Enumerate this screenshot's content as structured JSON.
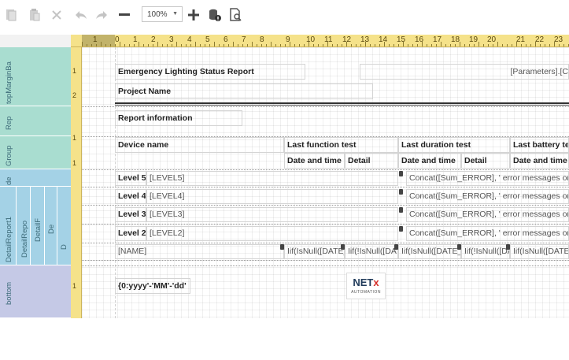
{
  "toolbar": {
    "zoom": "100%",
    "icons": [
      "copy-icon",
      "paste-icon",
      "delete-icon",
      "undo-icon",
      "redo-icon",
      "zoom-out-icon",
      "zoom-in-icon",
      "data-source-icon",
      "preview-icon"
    ]
  },
  "ruler": {
    "numbers": [
      "1",
      "0",
      "1",
      "2",
      "3",
      "4",
      "5",
      "6",
      "7",
      "8",
      "9",
      "10",
      "11",
      "12",
      "13",
      "14",
      "15",
      "16",
      "17",
      "18",
      "19",
      "20",
      "21",
      "22",
      "23"
    ],
    "vnumbers": [
      "1",
      "2",
      "1",
      "1",
      "1",
      "1"
    ]
  },
  "bands": {
    "top_margin": "topMarginBa",
    "report_header": "Rep",
    "group_header": "Group",
    "detail_de": "de",
    "detail_report1": "DetailReport1",
    "detail_repo": "DetailRepo",
    "detail_f": "DetailF",
    "detail_de2": "De",
    "detail_d": "D",
    "bottom_margin": "bottom"
  },
  "report": {
    "title": "Emergency Lighting Status Report",
    "parameters": "[Parameters].[C",
    "project": "Project Name",
    "info": "Report information",
    "headers": {
      "device_name": "Device name",
      "last_function_test": "Last function test",
      "last_duration_test": "Last duration test",
      "last_battery_test": "Last battery tes",
      "date_and_time_1": "Date and time",
      "detail_1": "Detail",
      "date_and_time_2": "Date and time",
      "detail_2": "Detail",
      "date_and_time_3": "Date and time"
    },
    "levels": [
      {
        "label": "Level 5",
        "field": "[LEVEL5]",
        "concat": "Concat([Sum_ERROR], ' error messages on ', [Cou"
      },
      {
        "label": "Level 4",
        "field": "[LEVEL4]",
        "concat": "Concat([Sum_ERROR], ' error messages on ', [Cou"
      },
      {
        "label": "Level 3",
        "field": "[LEVEL3]",
        "concat": "Concat([Sum_ERROR], ' error messages on ', [Cou"
      },
      {
        "label": "Level 2",
        "field": "[LEVEL2]",
        "concat": "Concat([Sum_ERROR], ' error messages on ', [Cou"
      }
    ],
    "detail": {
      "name": "[NAME]",
      "f1": "Iif(IsNull([DATE_F",
      "f2": "Iif(!IsNull([DA",
      "f3": "Iif(IsNull([DATE_D",
      "f4": "Iif(!IsNull([DA",
      "f5": "Iif(IsNull([DATE_E"
    },
    "date_format": "{0:yyyy'-'MM'-'dd'",
    "logo_main": "NET",
    "logo_x": "x",
    "logo_sub": "AUTOMATION"
  }
}
